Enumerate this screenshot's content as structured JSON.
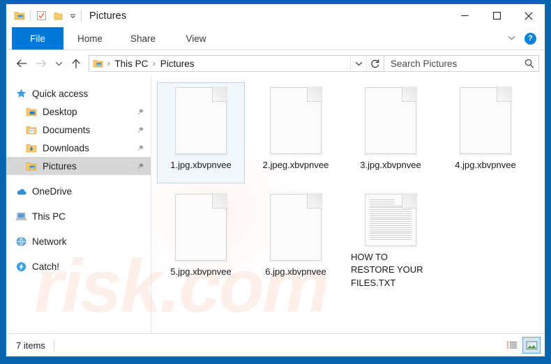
{
  "window": {
    "title": "Pictures",
    "quick_access_toolbar": [
      {
        "name": "folder-pictures-icon",
        "label": "Pictures properties"
      },
      {
        "name": "properties-icon",
        "label": "Properties"
      },
      {
        "name": "new-folder-icon",
        "label": "New folder"
      },
      {
        "name": "customize-chevron-icon",
        "label": "Customize Quick Access Toolbar"
      }
    ],
    "controls": {
      "minimize": "–",
      "maximize": "☐",
      "close": "✕"
    },
    "accent_color": "#0078d7",
    "frame_color": "#0a64ad"
  },
  "ribbon": {
    "tabs": [
      {
        "label": "File",
        "active": true
      },
      {
        "label": "Home",
        "active": false
      },
      {
        "label": "Share",
        "active": false
      },
      {
        "label": "View",
        "active": false
      }
    ],
    "expand_label": "∨",
    "help_label": "?"
  },
  "address_bar": {
    "back_label": "←",
    "forward_label": "→",
    "recent_label": "∨",
    "up_label": "↑",
    "breadcrumb": [
      {
        "label": "This PC"
      },
      {
        "label": "Pictures"
      }
    ],
    "separator": "›",
    "dropdown_label": "∨",
    "refresh_label": "↻"
  },
  "search": {
    "placeholder": "Search Pictures",
    "value": "",
    "icon": "search-icon"
  },
  "sidebar": {
    "items": [
      {
        "label": "Quick access",
        "icon": "star-icon",
        "level": "root",
        "selected": false,
        "pinned": false
      },
      {
        "label": "Desktop",
        "icon": "desktop-folder-icon",
        "level": "child",
        "selected": false,
        "pinned": true
      },
      {
        "label": "Documents",
        "icon": "documents-folder-icon",
        "level": "child",
        "selected": false,
        "pinned": true
      },
      {
        "label": "Downloads",
        "icon": "downloads-folder-icon",
        "level": "child",
        "selected": false,
        "pinned": true
      },
      {
        "label": "Pictures",
        "icon": "pictures-folder-icon",
        "level": "child",
        "selected": true,
        "pinned": true
      },
      {
        "label": "OneDrive",
        "icon": "onedrive-cloud-icon",
        "level": "root",
        "selected": false,
        "pinned": false
      },
      {
        "label": "This PC",
        "icon": "computer-icon",
        "level": "root",
        "selected": false,
        "pinned": false
      },
      {
        "label": "Network",
        "icon": "network-icon",
        "level": "root",
        "selected": false,
        "pinned": false
      },
      {
        "label": "Catch!",
        "icon": "catch-app-icon",
        "level": "root",
        "selected": false,
        "pinned": false
      }
    ]
  },
  "files": [
    {
      "name": "1.jpg.xbvpnvee",
      "icon": "blank-file-icon",
      "selected": true
    },
    {
      "name": "2.jpeg.xbvpnvee",
      "icon": "blank-file-icon",
      "selected": false
    },
    {
      "name": "3.jpg.xbvpnvee",
      "icon": "blank-file-icon",
      "selected": false
    },
    {
      "name": "4.jpg.xbvpnvee",
      "icon": "blank-file-icon",
      "selected": false
    },
    {
      "name": "5.jpg.xbvpnvee",
      "icon": "blank-file-icon",
      "selected": false
    },
    {
      "name": "6.jpg.xbvpnvee",
      "icon": "blank-file-icon",
      "selected": false
    },
    {
      "name": "HOW TO RESTORE YOUR FILES.TXT",
      "icon": "text-file-icon",
      "selected": false
    }
  ],
  "status_bar": {
    "item_count": "7 items",
    "views": [
      {
        "name": "details-view-button",
        "active": false
      },
      {
        "name": "large-icons-view-button",
        "active": true
      }
    ]
  },
  "watermark": {
    "text": "risk.com"
  }
}
